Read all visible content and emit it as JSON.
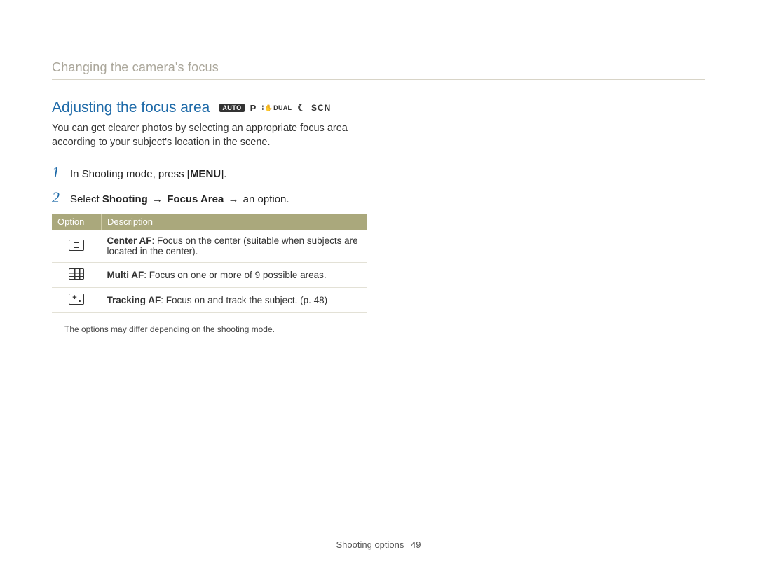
{
  "section_title": "Changing the camera's focus",
  "heading": "Adjusting the focus area",
  "modes": {
    "auto": "AUTO",
    "p": "P",
    "dual": "DUAL",
    "moon": "☾",
    "scn": "SCN"
  },
  "intro": "You can get clearer photos by selecting an appropriate focus area according to your subject's location in the scene.",
  "steps": [
    {
      "num": "1",
      "pre": "In Shooting mode, press [",
      "button": "MENU",
      "post": "]."
    },
    {
      "num": "2",
      "pre": "Select ",
      "b1": "Shooting",
      "arrow1": " → ",
      "b2": "Focus Area",
      "arrow2": " → ",
      "post": "an option."
    }
  ],
  "table": {
    "headers": {
      "option": "Option",
      "description": "Description"
    },
    "rows": [
      {
        "icon": "center",
        "name": "Center AF",
        "desc": ": Focus on the center (suitable when subjects are located in the center)."
      },
      {
        "icon": "multi",
        "name": "Multi AF",
        "desc": ": Focus on one or more of 9 possible areas."
      },
      {
        "icon": "track",
        "name": "Tracking AF",
        "desc": ": Focus on and track the subject. (p. 48)"
      }
    ]
  },
  "note": "The options may differ depending on the shooting mode.",
  "footer": {
    "label": "Shooting options",
    "page": "49"
  }
}
